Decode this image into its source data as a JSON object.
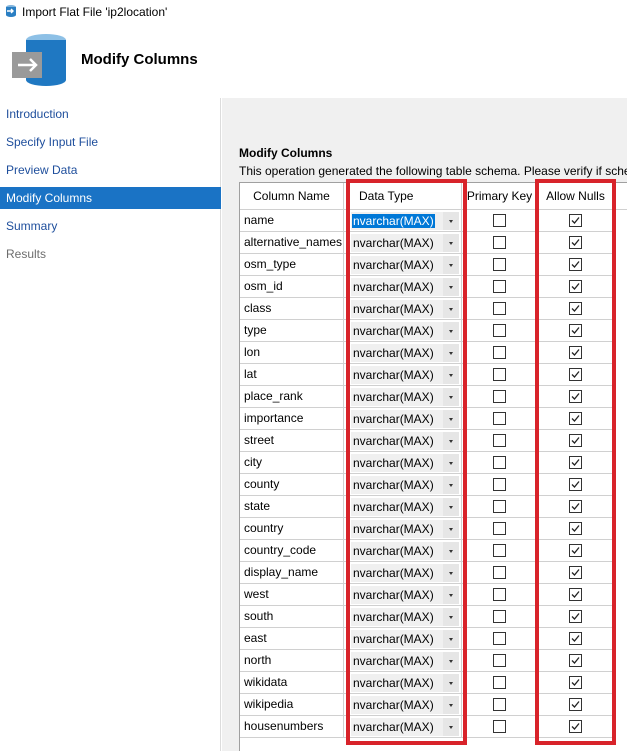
{
  "window": {
    "title": "Import Flat File 'ip2location'"
  },
  "header": {
    "title": "Modify Columns"
  },
  "sidebar": {
    "items": [
      {
        "label": "Introduction",
        "state": "normal"
      },
      {
        "label": "Specify Input File",
        "state": "normal"
      },
      {
        "label": "Preview Data",
        "state": "normal"
      },
      {
        "label": "Modify Columns",
        "state": "active"
      },
      {
        "label": "Summary",
        "state": "normal"
      },
      {
        "label": "Results",
        "state": "disabled"
      }
    ]
  },
  "main": {
    "section_title": "Modify Columns",
    "description": "This operation generated the following table schema. Please verify if schema is accurate, and if not, please make any changes.",
    "columns_header": {
      "name": "Column Name",
      "type": "Data Type",
      "pk": "Primary Key",
      "nulls": "Allow Nulls"
    },
    "rows": [
      {
        "name": "name",
        "type": "nvarchar(MAX)",
        "primary_key": false,
        "allow_nulls": true,
        "selected": true
      },
      {
        "name": "alternative_names",
        "type": "nvarchar(MAX)",
        "primary_key": false,
        "allow_nulls": true
      },
      {
        "name": "osm_type",
        "type": "nvarchar(MAX)",
        "primary_key": false,
        "allow_nulls": true
      },
      {
        "name": "osm_id",
        "type": "nvarchar(MAX)",
        "primary_key": false,
        "allow_nulls": true
      },
      {
        "name": "class",
        "type": "nvarchar(MAX)",
        "primary_key": false,
        "allow_nulls": true
      },
      {
        "name": "type",
        "type": "nvarchar(MAX)",
        "primary_key": false,
        "allow_nulls": true
      },
      {
        "name": "lon",
        "type": "nvarchar(MAX)",
        "primary_key": false,
        "allow_nulls": true
      },
      {
        "name": "lat",
        "type": "nvarchar(MAX)",
        "primary_key": false,
        "allow_nulls": true
      },
      {
        "name": "place_rank",
        "type": "nvarchar(MAX)",
        "primary_key": false,
        "allow_nulls": true
      },
      {
        "name": "importance",
        "type": "nvarchar(MAX)",
        "primary_key": false,
        "allow_nulls": true
      },
      {
        "name": "street",
        "type": "nvarchar(MAX)",
        "primary_key": false,
        "allow_nulls": true
      },
      {
        "name": "city",
        "type": "nvarchar(MAX)",
        "primary_key": false,
        "allow_nulls": true
      },
      {
        "name": "county",
        "type": "nvarchar(MAX)",
        "primary_key": false,
        "allow_nulls": true
      },
      {
        "name": "state",
        "type": "nvarchar(MAX)",
        "primary_key": false,
        "allow_nulls": true
      },
      {
        "name": "country",
        "type": "nvarchar(MAX)",
        "primary_key": false,
        "allow_nulls": true
      },
      {
        "name": "country_code",
        "type": "nvarchar(MAX)",
        "primary_key": false,
        "allow_nulls": true
      },
      {
        "name": "display_name",
        "type": "nvarchar(MAX)",
        "primary_key": false,
        "allow_nulls": true
      },
      {
        "name": "west",
        "type": "nvarchar(MAX)",
        "primary_key": false,
        "allow_nulls": true
      },
      {
        "name": "south",
        "type": "nvarchar(MAX)",
        "primary_key": false,
        "allow_nulls": true
      },
      {
        "name": "east",
        "type": "nvarchar(MAX)",
        "primary_key": false,
        "allow_nulls": true
      },
      {
        "name": "north",
        "type": "nvarchar(MAX)",
        "primary_key": false,
        "allow_nulls": true
      },
      {
        "name": "wikidata",
        "type": "nvarchar(MAX)",
        "primary_key": false,
        "allow_nulls": true
      },
      {
        "name": "wikipedia",
        "type": "nvarchar(MAX)",
        "primary_key": false,
        "allow_nulls": true
      },
      {
        "name": "housenumbers",
        "type": "nvarchar(MAX)",
        "primary_key": false,
        "allow_nulls": true
      }
    ]
  },
  "colors": {
    "active_nav_bg": "#1a73c5",
    "nav_link": "#1e4e9c",
    "selection": "#0078d7",
    "highlight_box": "#d8232a",
    "content_bg": "#f0f0f0"
  },
  "icons": {
    "app": "import-flat-file-icon",
    "header": "database-import-icon",
    "checkbox": "checkmark-icon",
    "dropdown": "chevron-down-icon"
  }
}
